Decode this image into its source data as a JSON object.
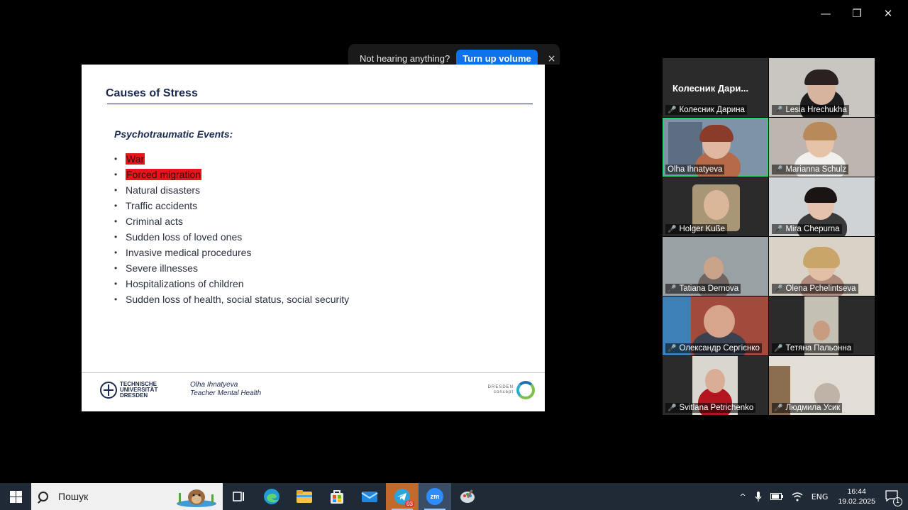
{
  "window": {
    "minimize_glyph": "—",
    "maximize_glyph": "❐",
    "close_glyph": "✕"
  },
  "toast": {
    "message": "Not hearing anything?",
    "button": "Turn up volume",
    "close_glyph": "×"
  },
  "slide": {
    "title": "Causes of Stress",
    "subtitle": "Psychotraumatic Events:",
    "bullets": [
      "War",
      "Forced migration",
      "Natural disasters",
      "Traffic accidents",
      "Criminal acts",
      "Sudden loss of loved ones",
      "Invasive medical procedures",
      "Severe illnesses",
      "Hospitalizations of children",
      "Sudden loss of health, social status, social security"
    ],
    "bullet_glyph": "•",
    "highlight_color": "#e8141b",
    "footer": {
      "logo_line1": "TECHNISCHE",
      "logo_line2": "UNIVERSITÄT",
      "logo_line3": "DRESDEN",
      "author": "Olha Ihnatyeva",
      "course": "Teacher Mental Health",
      "partner_line1": "DRESDEN",
      "partner_line2": "concept"
    }
  },
  "gallery": {
    "big_name": "Колесник  Дари...",
    "mic_glyph": "🎤",
    "participants": [
      "Колесник Дарина",
      "Lesia Hrechukha",
      "Olha Ihnatyeva",
      "Marianna Schulz",
      "Holger Kuße",
      "Mira Chepurna",
      "Tatiana Dernova",
      "Olena Pchelintseva",
      "Олександр Сергієнко",
      "Тетяна Пальонна",
      "Svitlana Petrichenko",
      "Людмила Усик"
    ],
    "active_speaker_color": "#23d959",
    "muted_color": "#e0393e"
  },
  "taskbar": {
    "search_text": "Пошук",
    "telegram_badge": "03",
    "zoom_label": "zm",
    "tray_chevron": "^",
    "language": "ENG",
    "time": "16:44",
    "date": "19.02.2025",
    "notification_count": "1"
  }
}
